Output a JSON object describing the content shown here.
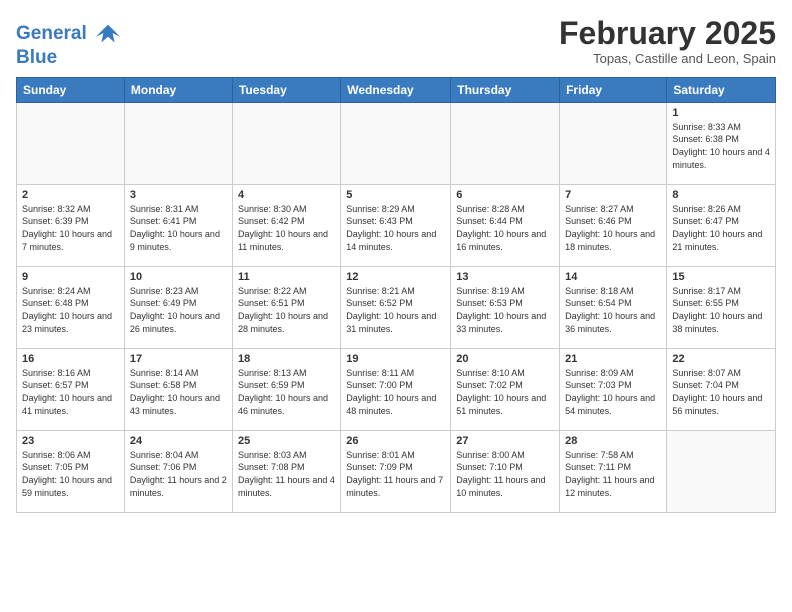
{
  "header": {
    "logo_line1": "General",
    "logo_line2": "Blue",
    "month": "February 2025",
    "location": "Topas, Castille and Leon, Spain"
  },
  "weekdays": [
    "Sunday",
    "Monday",
    "Tuesday",
    "Wednesday",
    "Thursday",
    "Friday",
    "Saturday"
  ],
  "weeks": [
    [
      {
        "day": "",
        "info": ""
      },
      {
        "day": "",
        "info": ""
      },
      {
        "day": "",
        "info": ""
      },
      {
        "day": "",
        "info": ""
      },
      {
        "day": "",
        "info": ""
      },
      {
        "day": "",
        "info": ""
      },
      {
        "day": "1",
        "info": "Sunrise: 8:33 AM\nSunset: 6:38 PM\nDaylight: 10 hours and 4 minutes."
      }
    ],
    [
      {
        "day": "2",
        "info": "Sunrise: 8:32 AM\nSunset: 6:39 PM\nDaylight: 10 hours and 7 minutes."
      },
      {
        "day": "3",
        "info": "Sunrise: 8:31 AM\nSunset: 6:41 PM\nDaylight: 10 hours and 9 minutes."
      },
      {
        "day": "4",
        "info": "Sunrise: 8:30 AM\nSunset: 6:42 PM\nDaylight: 10 hours and 11 minutes."
      },
      {
        "day": "5",
        "info": "Sunrise: 8:29 AM\nSunset: 6:43 PM\nDaylight: 10 hours and 14 minutes."
      },
      {
        "day": "6",
        "info": "Sunrise: 8:28 AM\nSunset: 6:44 PM\nDaylight: 10 hours and 16 minutes."
      },
      {
        "day": "7",
        "info": "Sunrise: 8:27 AM\nSunset: 6:46 PM\nDaylight: 10 hours and 18 minutes."
      },
      {
        "day": "8",
        "info": "Sunrise: 8:26 AM\nSunset: 6:47 PM\nDaylight: 10 hours and 21 minutes."
      }
    ],
    [
      {
        "day": "9",
        "info": "Sunrise: 8:24 AM\nSunset: 6:48 PM\nDaylight: 10 hours and 23 minutes."
      },
      {
        "day": "10",
        "info": "Sunrise: 8:23 AM\nSunset: 6:49 PM\nDaylight: 10 hours and 26 minutes."
      },
      {
        "day": "11",
        "info": "Sunrise: 8:22 AM\nSunset: 6:51 PM\nDaylight: 10 hours and 28 minutes."
      },
      {
        "day": "12",
        "info": "Sunrise: 8:21 AM\nSunset: 6:52 PM\nDaylight: 10 hours and 31 minutes."
      },
      {
        "day": "13",
        "info": "Sunrise: 8:19 AM\nSunset: 6:53 PM\nDaylight: 10 hours and 33 minutes."
      },
      {
        "day": "14",
        "info": "Sunrise: 8:18 AM\nSunset: 6:54 PM\nDaylight: 10 hours and 36 minutes."
      },
      {
        "day": "15",
        "info": "Sunrise: 8:17 AM\nSunset: 6:55 PM\nDaylight: 10 hours and 38 minutes."
      }
    ],
    [
      {
        "day": "16",
        "info": "Sunrise: 8:16 AM\nSunset: 6:57 PM\nDaylight: 10 hours and 41 minutes."
      },
      {
        "day": "17",
        "info": "Sunrise: 8:14 AM\nSunset: 6:58 PM\nDaylight: 10 hours and 43 minutes."
      },
      {
        "day": "18",
        "info": "Sunrise: 8:13 AM\nSunset: 6:59 PM\nDaylight: 10 hours and 46 minutes."
      },
      {
        "day": "19",
        "info": "Sunrise: 8:11 AM\nSunset: 7:00 PM\nDaylight: 10 hours and 48 minutes."
      },
      {
        "day": "20",
        "info": "Sunrise: 8:10 AM\nSunset: 7:02 PM\nDaylight: 10 hours and 51 minutes."
      },
      {
        "day": "21",
        "info": "Sunrise: 8:09 AM\nSunset: 7:03 PM\nDaylight: 10 hours and 54 minutes."
      },
      {
        "day": "22",
        "info": "Sunrise: 8:07 AM\nSunset: 7:04 PM\nDaylight: 10 hours and 56 minutes."
      }
    ],
    [
      {
        "day": "23",
        "info": "Sunrise: 8:06 AM\nSunset: 7:05 PM\nDaylight: 10 hours and 59 minutes."
      },
      {
        "day": "24",
        "info": "Sunrise: 8:04 AM\nSunset: 7:06 PM\nDaylight: 11 hours and 2 minutes."
      },
      {
        "day": "25",
        "info": "Sunrise: 8:03 AM\nSunset: 7:08 PM\nDaylight: 11 hours and 4 minutes."
      },
      {
        "day": "26",
        "info": "Sunrise: 8:01 AM\nSunset: 7:09 PM\nDaylight: 11 hours and 7 minutes."
      },
      {
        "day": "27",
        "info": "Sunrise: 8:00 AM\nSunset: 7:10 PM\nDaylight: 11 hours and 10 minutes."
      },
      {
        "day": "28",
        "info": "Sunrise: 7:58 AM\nSunset: 7:11 PM\nDaylight: 11 hours and 12 minutes."
      },
      {
        "day": "",
        "info": ""
      }
    ]
  ]
}
